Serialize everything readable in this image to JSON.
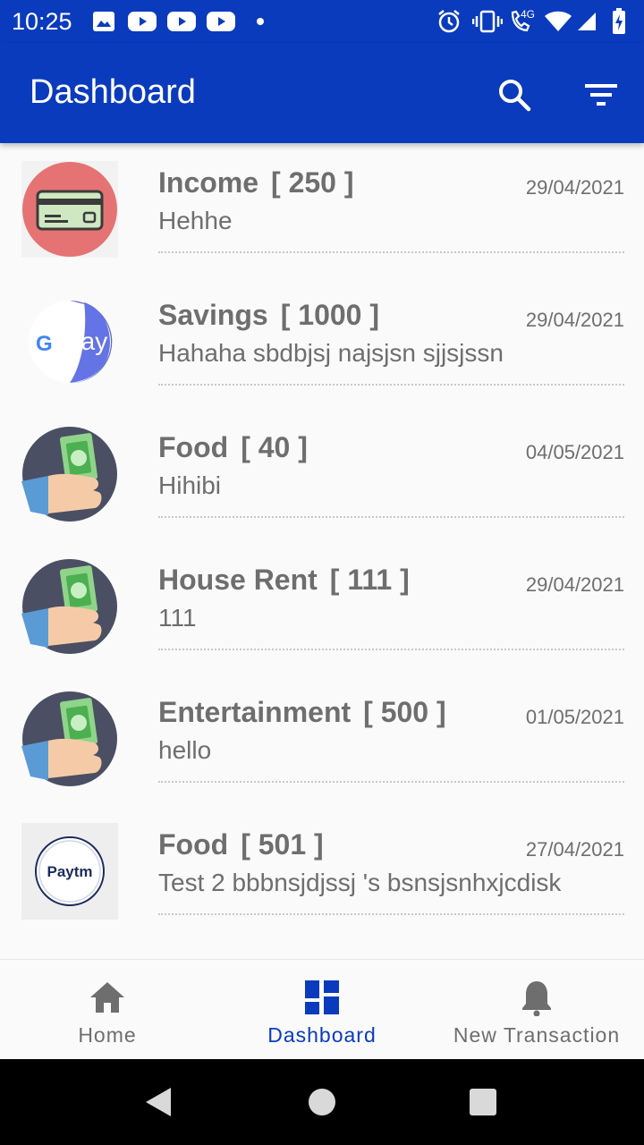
{
  "status_bar": {
    "time": "10:25",
    "left_icons": [
      "image-icon",
      "youtube-icon",
      "youtube-icon",
      "youtube-icon",
      "dot-icon"
    ],
    "right_icons": [
      "alarm-icon",
      "vibrate-icon",
      "wifi-calling-icon",
      "signal-4g-icon",
      "wifi-icon",
      "cell-signal-icon",
      "battery-charging-icon"
    ],
    "network_label": "4G"
  },
  "app_bar": {
    "title": "Dashboard",
    "actions": [
      "search-icon",
      "filter-icon"
    ]
  },
  "transactions": [
    {
      "title": "Income",
      "amount": "[ 250 ]",
      "date": "29/04/2021",
      "description": "Hehhe",
      "icon": "credit-card-icon"
    },
    {
      "title": "Savings",
      "amount": "[ 1000 ]",
      "date": "29/04/2021",
      "description": "Hahaha sbdbjsj najsjsn sjjsjssn",
      "icon": "gpay-icon"
    },
    {
      "title": "Food",
      "amount": "[ 40 ]",
      "date": "04/05/2021",
      "description": "Hihibi",
      "icon": "cash-hand-icon"
    },
    {
      "title": "House Rent",
      "amount": "[ 111 ]",
      "date": "29/04/2021",
      "description": "111",
      "icon": "cash-hand-icon"
    },
    {
      "title": "Entertainment",
      "amount": "[ 500 ]",
      "date": "01/05/2021",
      "description": "hello",
      "icon": "cash-hand-icon"
    },
    {
      "title": "Food",
      "amount": "[ 501 ]",
      "date": "27/04/2021",
      "description": "Test 2 bbbnsjdjssj 's bsnsjsnhxjcdisk",
      "icon": "paytm-icon"
    }
  ],
  "logos": {
    "gpay_g": "G",
    "gpay_text": "Pay",
    "paytm_text": "Paytm"
  },
  "bottom_nav": {
    "items": [
      {
        "label": "Home",
        "icon": "home-icon",
        "active": false
      },
      {
        "label": "Dashboard",
        "icon": "dashboard-icon",
        "active": true
      },
      {
        "label": "New Transaction",
        "icon": "bell-icon",
        "active": false
      }
    ]
  },
  "system_nav": [
    "back-icon",
    "home-circle-icon",
    "recents-icon"
  ],
  "colors": {
    "primary": "#0a3bbd",
    "text_muted": "#6e6e6e",
    "background": "#fafafa",
    "card_red": "#e57373",
    "navy_circle": "#4a4f63"
  }
}
